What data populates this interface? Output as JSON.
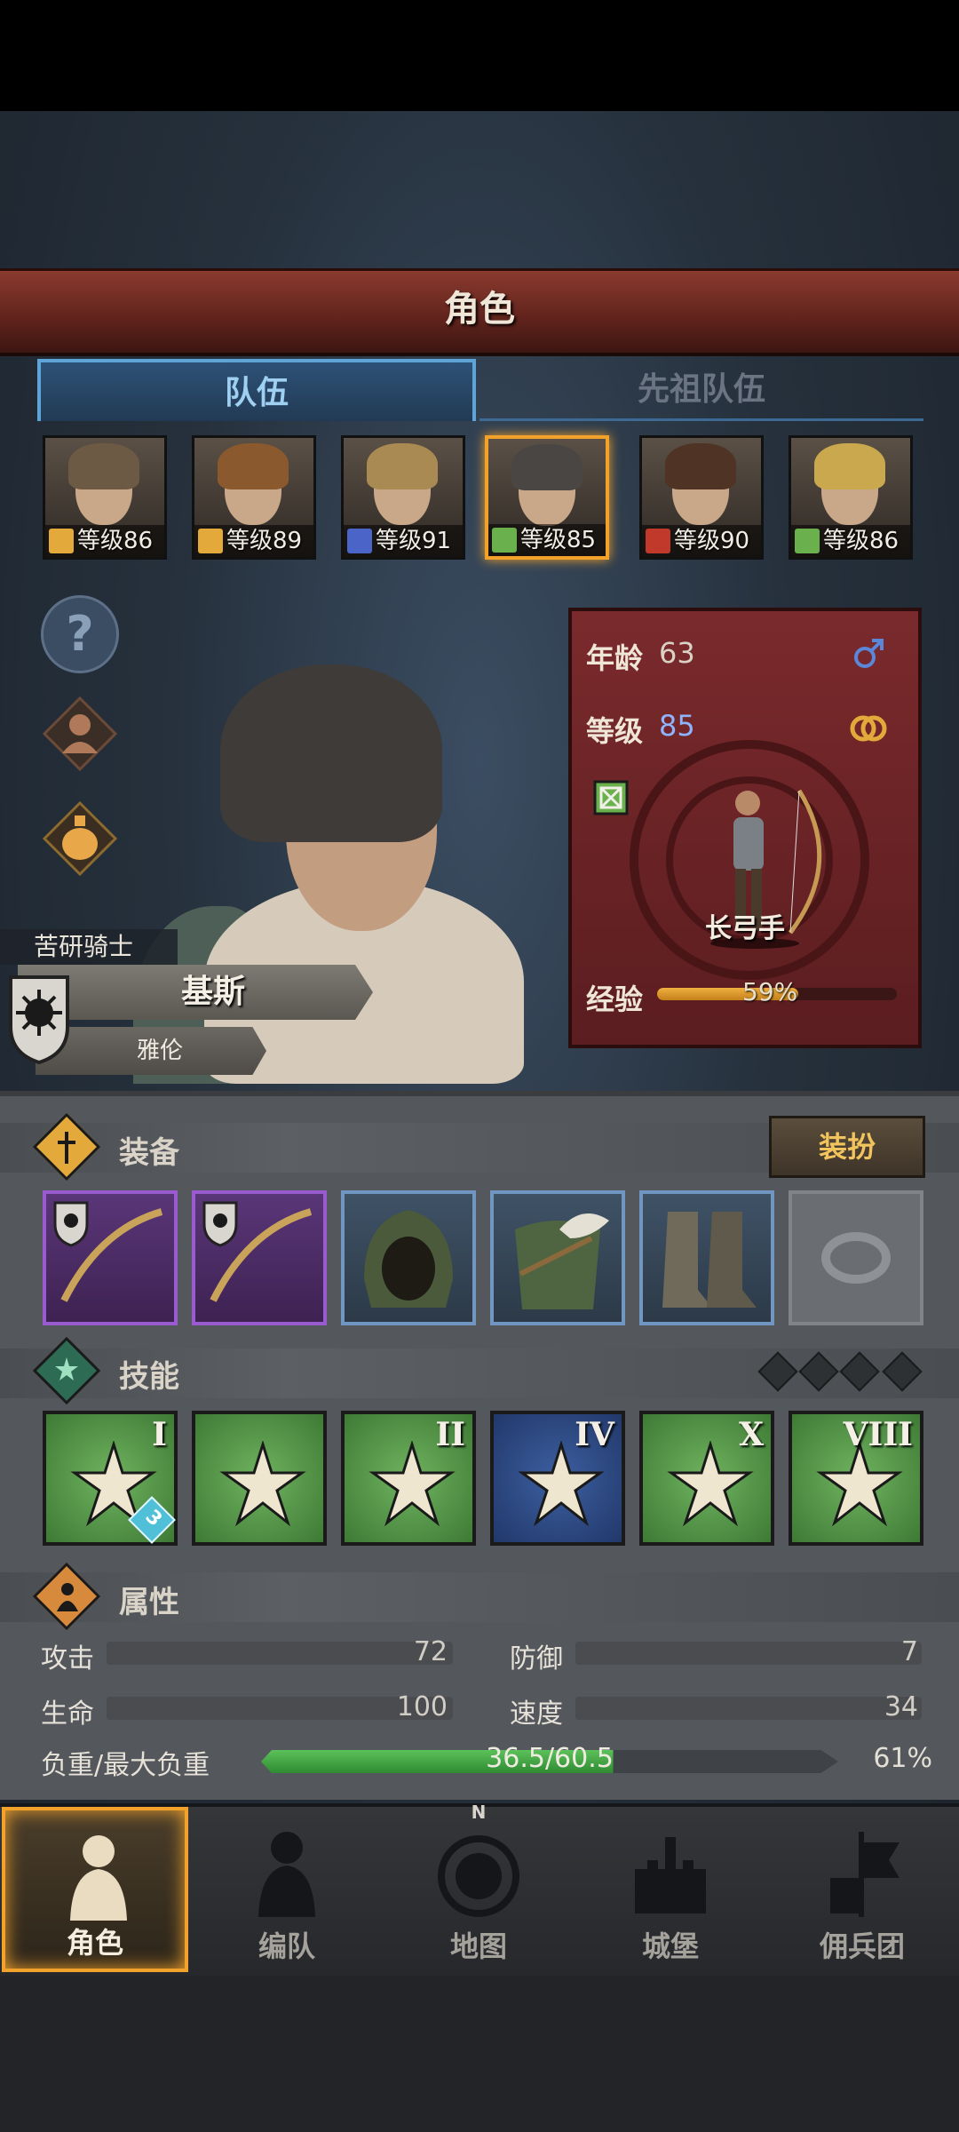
{
  "header": {
    "title": "角色"
  },
  "tabs": [
    {
      "label": "队伍",
      "active": true
    },
    {
      "label": "先祖队伍",
      "active": false
    }
  ],
  "party": [
    {
      "level_label": "等级86",
      "class_icon": "shield-icon",
      "icon_color": "#e3a93b",
      "hair": "#6d5a44"
    },
    {
      "level_label": "等级89",
      "class_icon": "shield-icon",
      "icon_color": "#e3a93b",
      "hair": "#8a5a2e"
    },
    {
      "level_label": "等级91",
      "class_icon": "sword-icon",
      "icon_color": "#4b64c8",
      "hair": "#a88a52"
    },
    {
      "level_label": "等级85",
      "class_icon": "bow-icon",
      "icon_color": "#6ab04c",
      "hair": "#4a4643",
      "selected": true
    },
    {
      "level_label": "等级90",
      "class_icon": "wolf-icon",
      "icon_color": "#c0392b",
      "hair": "#4f3324"
    },
    {
      "level_label": "等级86",
      "class_icon": "bow-icon",
      "icon_color": "#6ab04c",
      "hair": "#c9a84e"
    }
  ],
  "character": {
    "class_title": "苦研骑士",
    "name": "基斯",
    "surname": "雅伦",
    "age_label": "年龄",
    "age": "63",
    "gender_icon": "male-icon",
    "level_label": "等级",
    "level": "85",
    "trait_icon": "ring-icon",
    "class_icon": "bow-icon",
    "role": "长弓手",
    "exp_label": "经验",
    "exp_text": "59%",
    "exp_fraction": 0.59
  },
  "equipment": {
    "title": "装备",
    "dress_button": "装扮",
    "items": [
      {
        "name": "longbow",
        "rarity": "purple"
      },
      {
        "name": "longbow",
        "rarity": "purple"
      },
      {
        "name": "hood",
        "rarity": "blue"
      },
      {
        "name": "fur-armor",
        "rarity": "blue"
      },
      {
        "name": "boots",
        "rarity": "blue"
      },
      {
        "name": "ring-slot-empty",
        "rarity": "empty"
      }
    ]
  },
  "skills": {
    "title": "技能",
    "items": [
      {
        "rank": "I",
        "style": "green",
        "badge": "3"
      },
      {
        "rank": "",
        "style": "green"
      },
      {
        "rank": "II",
        "style": "green"
      },
      {
        "rank": "IV",
        "style": "blue"
      },
      {
        "rank": "X",
        "style": "green"
      },
      {
        "rank": "VIII",
        "style": "green"
      }
    ]
  },
  "attributes": {
    "title": "属性",
    "attack_label": "攻击",
    "attack": "72",
    "defense_label": "防御",
    "defense": "7",
    "hp_label": "生命",
    "hp": "100",
    "speed_label": "速度",
    "speed": "34",
    "load_label": "负重/最大负重",
    "load_text": "36.5/60.5",
    "load_pct": "61%",
    "load_fraction": 0.61
  },
  "nav": [
    {
      "label": "角色",
      "icon": "knight-icon",
      "active": true
    },
    {
      "label": "编队",
      "icon": "formation-icon"
    },
    {
      "label": "地图",
      "icon": "compass-icon",
      "compass_mark": "N"
    },
    {
      "label": "城堡",
      "icon": "castle-icon"
    },
    {
      "label": "佣兵团",
      "icon": "banner-icon"
    }
  ]
}
